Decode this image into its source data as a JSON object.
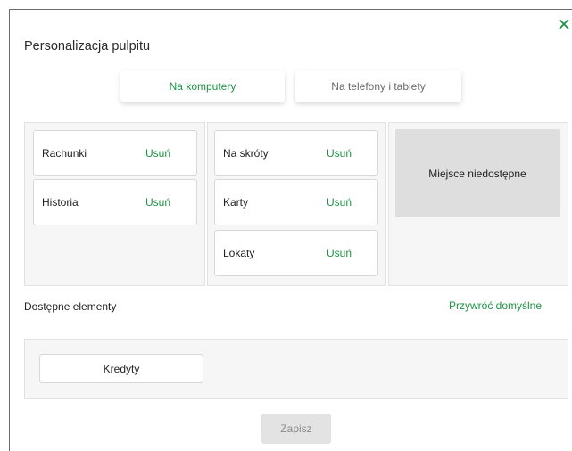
{
  "dialog": {
    "title": "Personalizacja pulpitu",
    "close_icon": "close-icon"
  },
  "tabs": [
    {
      "label": "Na komputery",
      "active": true
    },
    {
      "label": "Na telefony i tablety",
      "active": false
    }
  ],
  "columns": [
    {
      "cards": [
        {
          "label": "Rachunki",
          "action": "Usuń"
        },
        {
          "label": "Historia",
          "action": "Usuń"
        }
      ]
    },
    {
      "cards": [
        {
          "label": "Na skróty",
          "action": "Usuń"
        },
        {
          "label": "Karty",
          "action": "Usuń"
        },
        {
          "label": "Lokaty",
          "action": "Usuń"
        }
      ]
    },
    {
      "placeholder": "Miejsce niedostępne"
    }
  ],
  "available": {
    "label": "Dostępne elementy",
    "restore_label": "Przywróć domyślne",
    "items": [
      {
        "label": "Kredyty"
      }
    ]
  },
  "footer": {
    "save_label": "Zapisz",
    "save_disabled": true
  },
  "colors": {
    "accent": "#1e9146",
    "panel_bg": "#f6f6f6",
    "placeholder_bg": "#dedede",
    "disabled_bg": "#e3e3e3"
  }
}
